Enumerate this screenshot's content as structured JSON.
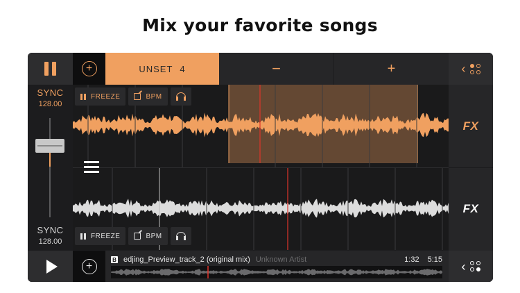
{
  "headline": "Mix your favorite songs",
  "top_bar": {
    "pause_icon": "pause-icon",
    "add_icon": "plus-circle-icon",
    "loop_label": "UNSET",
    "loop_value": "4",
    "decrease_label": "−",
    "increase_label": "+",
    "menu_chevron": "‹"
  },
  "deck_top": {
    "sync_label": "SYNC",
    "bpm_value": "128.00",
    "freeze_label": "FREEZE",
    "bpm_label": "BPM",
    "fx_label": "FX",
    "color": "#f0a060"
  },
  "deck_bottom": {
    "sync_label": "SYNC",
    "bpm_value": "128.00",
    "freeze_label": "FREEZE",
    "bpm_label": "BPM",
    "fx_label": "FX",
    "color": "#e8e8e8"
  },
  "bottom_bar": {
    "play_icon": "play-icon",
    "add_icon": "plus-circle-icon",
    "deck_letter": "B",
    "track_name": "edjing_Preview_track_2 (original mix)",
    "artist": "Unknown Artist",
    "elapsed": "1:32",
    "duration": "5:15",
    "menu_chevron": "‹"
  },
  "colors": {
    "accent": "#f0a060",
    "playhead": "#e0342a",
    "background": "#1c1c1e"
  }
}
